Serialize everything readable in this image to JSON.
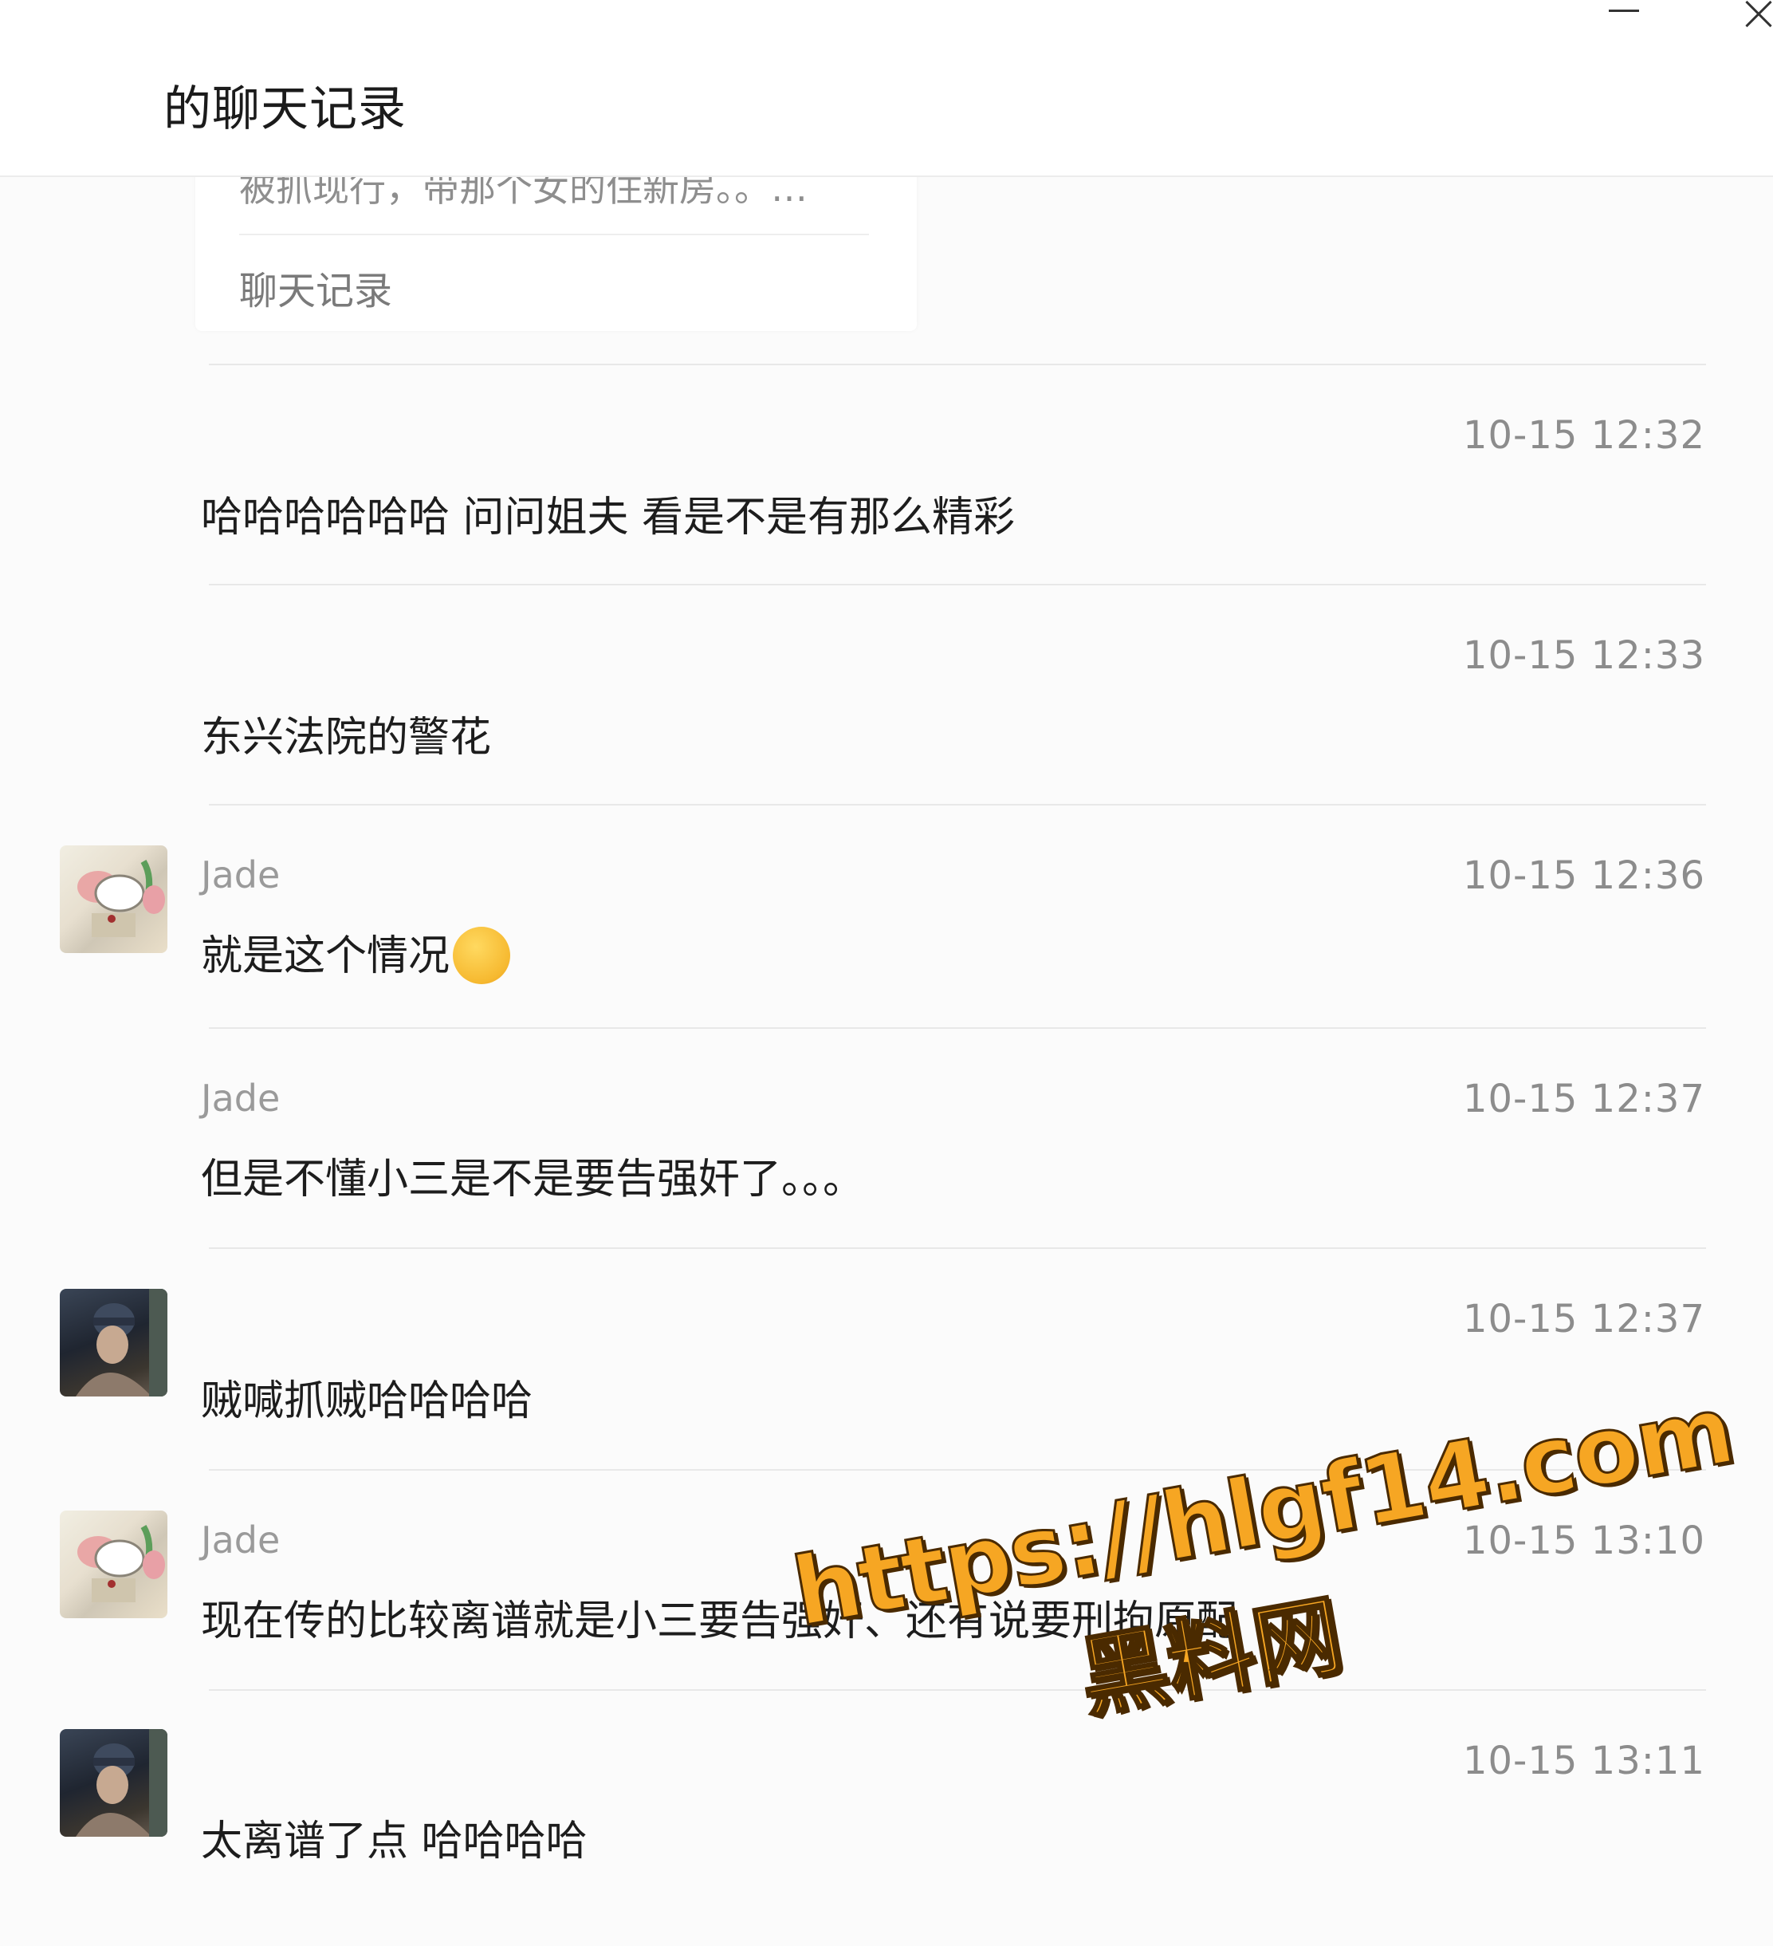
{
  "window": {
    "title": "的聊天记录",
    "minimize_label": "—",
    "close_label": "×"
  },
  "nested_record": {
    "preview": "被抓现行，带那个女的住新房。。…",
    "label": "聊天记录"
  },
  "messages": [
    {
      "sender": "",
      "avatar": "",
      "time": "10-15 12:32",
      "text": "哈哈哈哈哈哈 问问姐夫 看是不是有那么精彩"
    },
    {
      "sender": "",
      "avatar": "",
      "time": "10-15 12:33",
      "text": "东兴法院的警花"
    },
    {
      "sender": "Jade",
      "avatar": "jade-avatar",
      "time": "10-15 12:36",
      "text": "就是这个情况",
      "emoji": "laugh-cry-emoji"
    },
    {
      "sender": "Jade",
      "avatar": "",
      "time": "10-15 12:37",
      "text": "但是不懂小三是不是要告强奸了。。。"
    },
    {
      "sender": "",
      "avatar": "dark-avatar",
      "time": "10-15 12:37",
      "text": "贼喊抓贼哈哈哈哈"
    },
    {
      "sender": "Jade",
      "avatar": "jade-avatar",
      "time": "10-15 13:10",
      "text": "现在传的比较离谱就是小三要告强奸、还有说要刑拘原配"
    },
    {
      "sender": "",
      "avatar": "dark-avatar",
      "time": "10-15 13:11",
      "text": "太离谱了点 哈哈哈哈"
    }
  ],
  "watermark": {
    "url": "https://hlgf14.com",
    "site": "黑料网"
  }
}
